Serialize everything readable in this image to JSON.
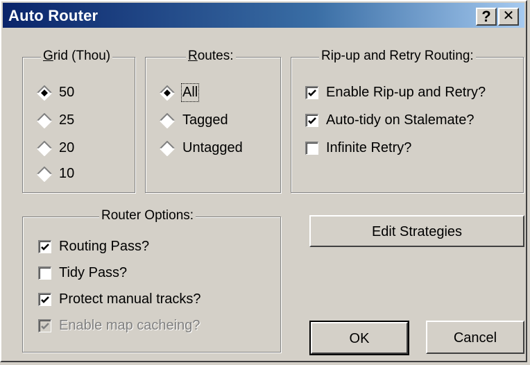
{
  "window": {
    "title": "Auto Router",
    "help_glyph": "?",
    "close_glyph": "✕"
  },
  "grid": {
    "label": "Grid (Thou)",
    "options": [
      {
        "label": "50",
        "selected": true
      },
      {
        "label": "25",
        "selected": false
      },
      {
        "label": "20",
        "selected": false
      },
      {
        "label": "10",
        "selected": false
      }
    ]
  },
  "routes": {
    "label": "Routes:",
    "options": [
      {
        "label": "All",
        "selected": true
      },
      {
        "label": "Tagged",
        "selected": false
      },
      {
        "label": "Untagged",
        "selected": false
      }
    ]
  },
  "ripup": {
    "label": "Rip-up and Retry Routing:",
    "options": [
      {
        "label": "Enable Rip-up and Retry?",
        "checked": true
      },
      {
        "label": "Auto-tidy on Stalemate?",
        "checked": true
      },
      {
        "label": "Infinite Retry?",
        "checked": false
      }
    ]
  },
  "router_options": {
    "label": "Router Options:",
    "options": [
      {
        "label": "Routing Pass?",
        "checked": true,
        "enabled": true
      },
      {
        "label": "Tidy Pass?",
        "checked": false,
        "enabled": true
      },
      {
        "label": "Protect manual tracks?",
        "checked": true,
        "enabled": true
      },
      {
        "label": "Enable map cacheing?",
        "checked": true,
        "enabled": false
      }
    ]
  },
  "buttons": {
    "edit_strategies": "Edit Strategies",
    "ok": "OK",
    "cancel": "Cancel"
  },
  "colors": {
    "face": "#d4d0c8",
    "title_start": "#0a246a",
    "title_end": "#a6caf0"
  }
}
